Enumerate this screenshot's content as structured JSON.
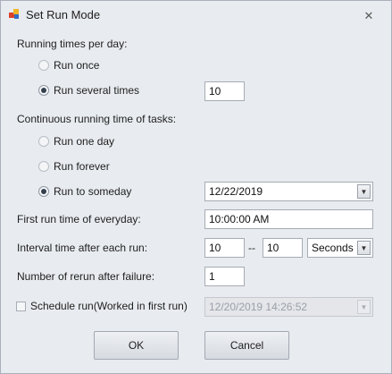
{
  "window": {
    "title": "Set Run Mode",
    "close_glyph": "✕",
    "icon": "app-icon"
  },
  "times_per_day": {
    "heading": "Running times per day:",
    "options": [
      {
        "label": "Run once",
        "checked": false
      },
      {
        "label": "Run several times",
        "checked": true
      }
    ],
    "count_value": "10"
  },
  "continuous": {
    "heading": "Continuous running time of tasks:",
    "options": [
      {
        "label": "Run one day",
        "checked": false
      },
      {
        "label": "Run forever",
        "checked": false
      },
      {
        "label": "Run to someday",
        "checked": true
      }
    ],
    "end_date": "12/22/2019"
  },
  "first_run": {
    "label": "First run time of everyday:",
    "value": "10:00:00 AM"
  },
  "interval": {
    "label": "Interval time after each run:",
    "from": "10",
    "separator": "--",
    "to": "10",
    "unit": "Seconds"
  },
  "rerun": {
    "label": "Number of rerun after failure:",
    "value": "1"
  },
  "schedule": {
    "label": "Schedule run(Worked in first run)",
    "checked": false,
    "datetime": "12/20/2019 14:26:52",
    "enabled": false
  },
  "buttons": {
    "ok": "OK",
    "cancel": "Cancel"
  },
  "arrow_glyph": "▼"
}
